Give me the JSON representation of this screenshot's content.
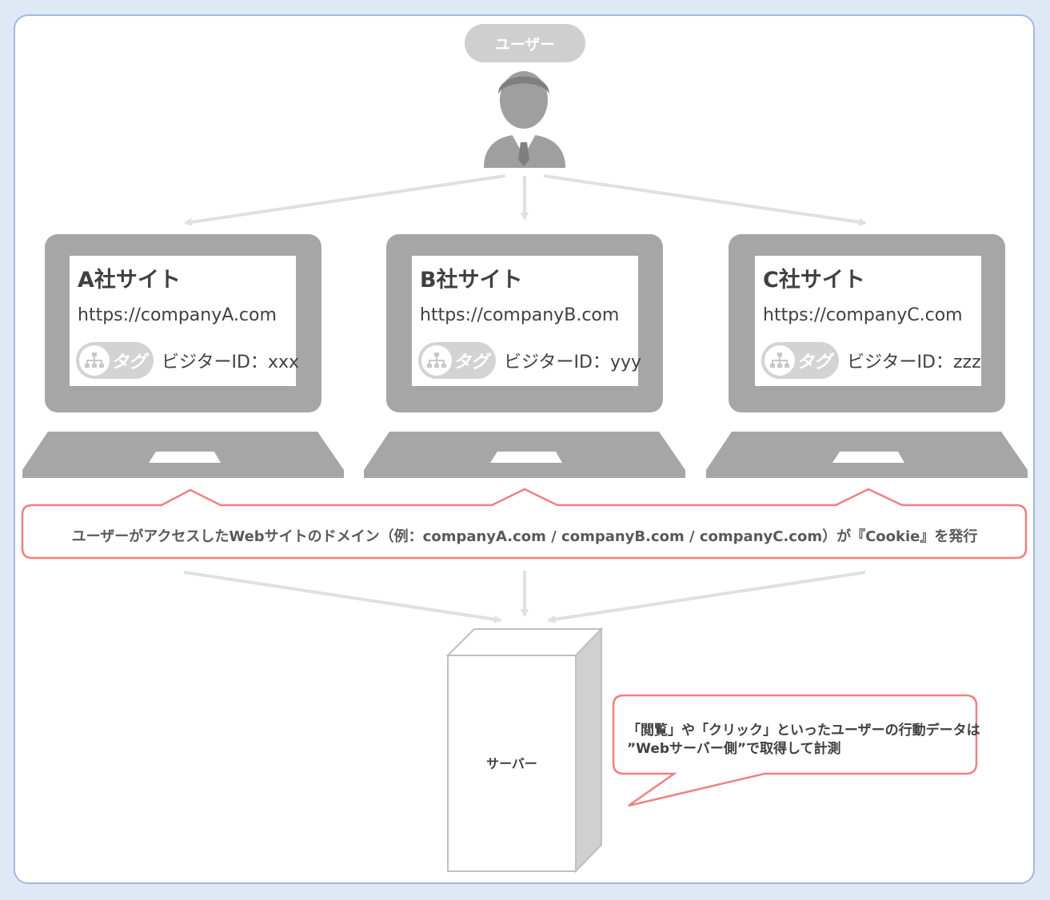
{
  "user": {
    "label": "ユーザー"
  },
  "sites": [
    {
      "name": "A社サイト",
      "url": "https://companyA.com",
      "tag_label": "タグ",
      "visitor_id": "ビジターID：xxx"
    },
    {
      "name": "B社サイト",
      "url": "https://companyB.com",
      "tag_label": "タグ",
      "visitor_id": "ビジターID：yyy"
    },
    {
      "name": "C社サイト",
      "url": "https://companyC.com",
      "tag_label": "タグ",
      "visitor_id": "ビジターID：zzz"
    }
  ],
  "cookie_callout": {
    "text": "ユーザーがアクセスしたWebサイトのドメイン（例：companyA.com / companyB.com / companyC.com）が『Cookie』を発行"
  },
  "server": {
    "label": "サーバー"
  },
  "server_callout": {
    "line1": "「閲覧」や「クリック」といったユーザーの行動データは",
    "line2": "”Webサーバー側”で取得して計測"
  },
  "colors": {
    "accent_red": "#f08080",
    "device_gray": "#a6a6a6",
    "frame_blue": "#a3b8e0",
    "background": "#dfe9f5"
  },
  "icons": {
    "user": "user-person-icon",
    "tag": "tag-sitemap-icon"
  }
}
